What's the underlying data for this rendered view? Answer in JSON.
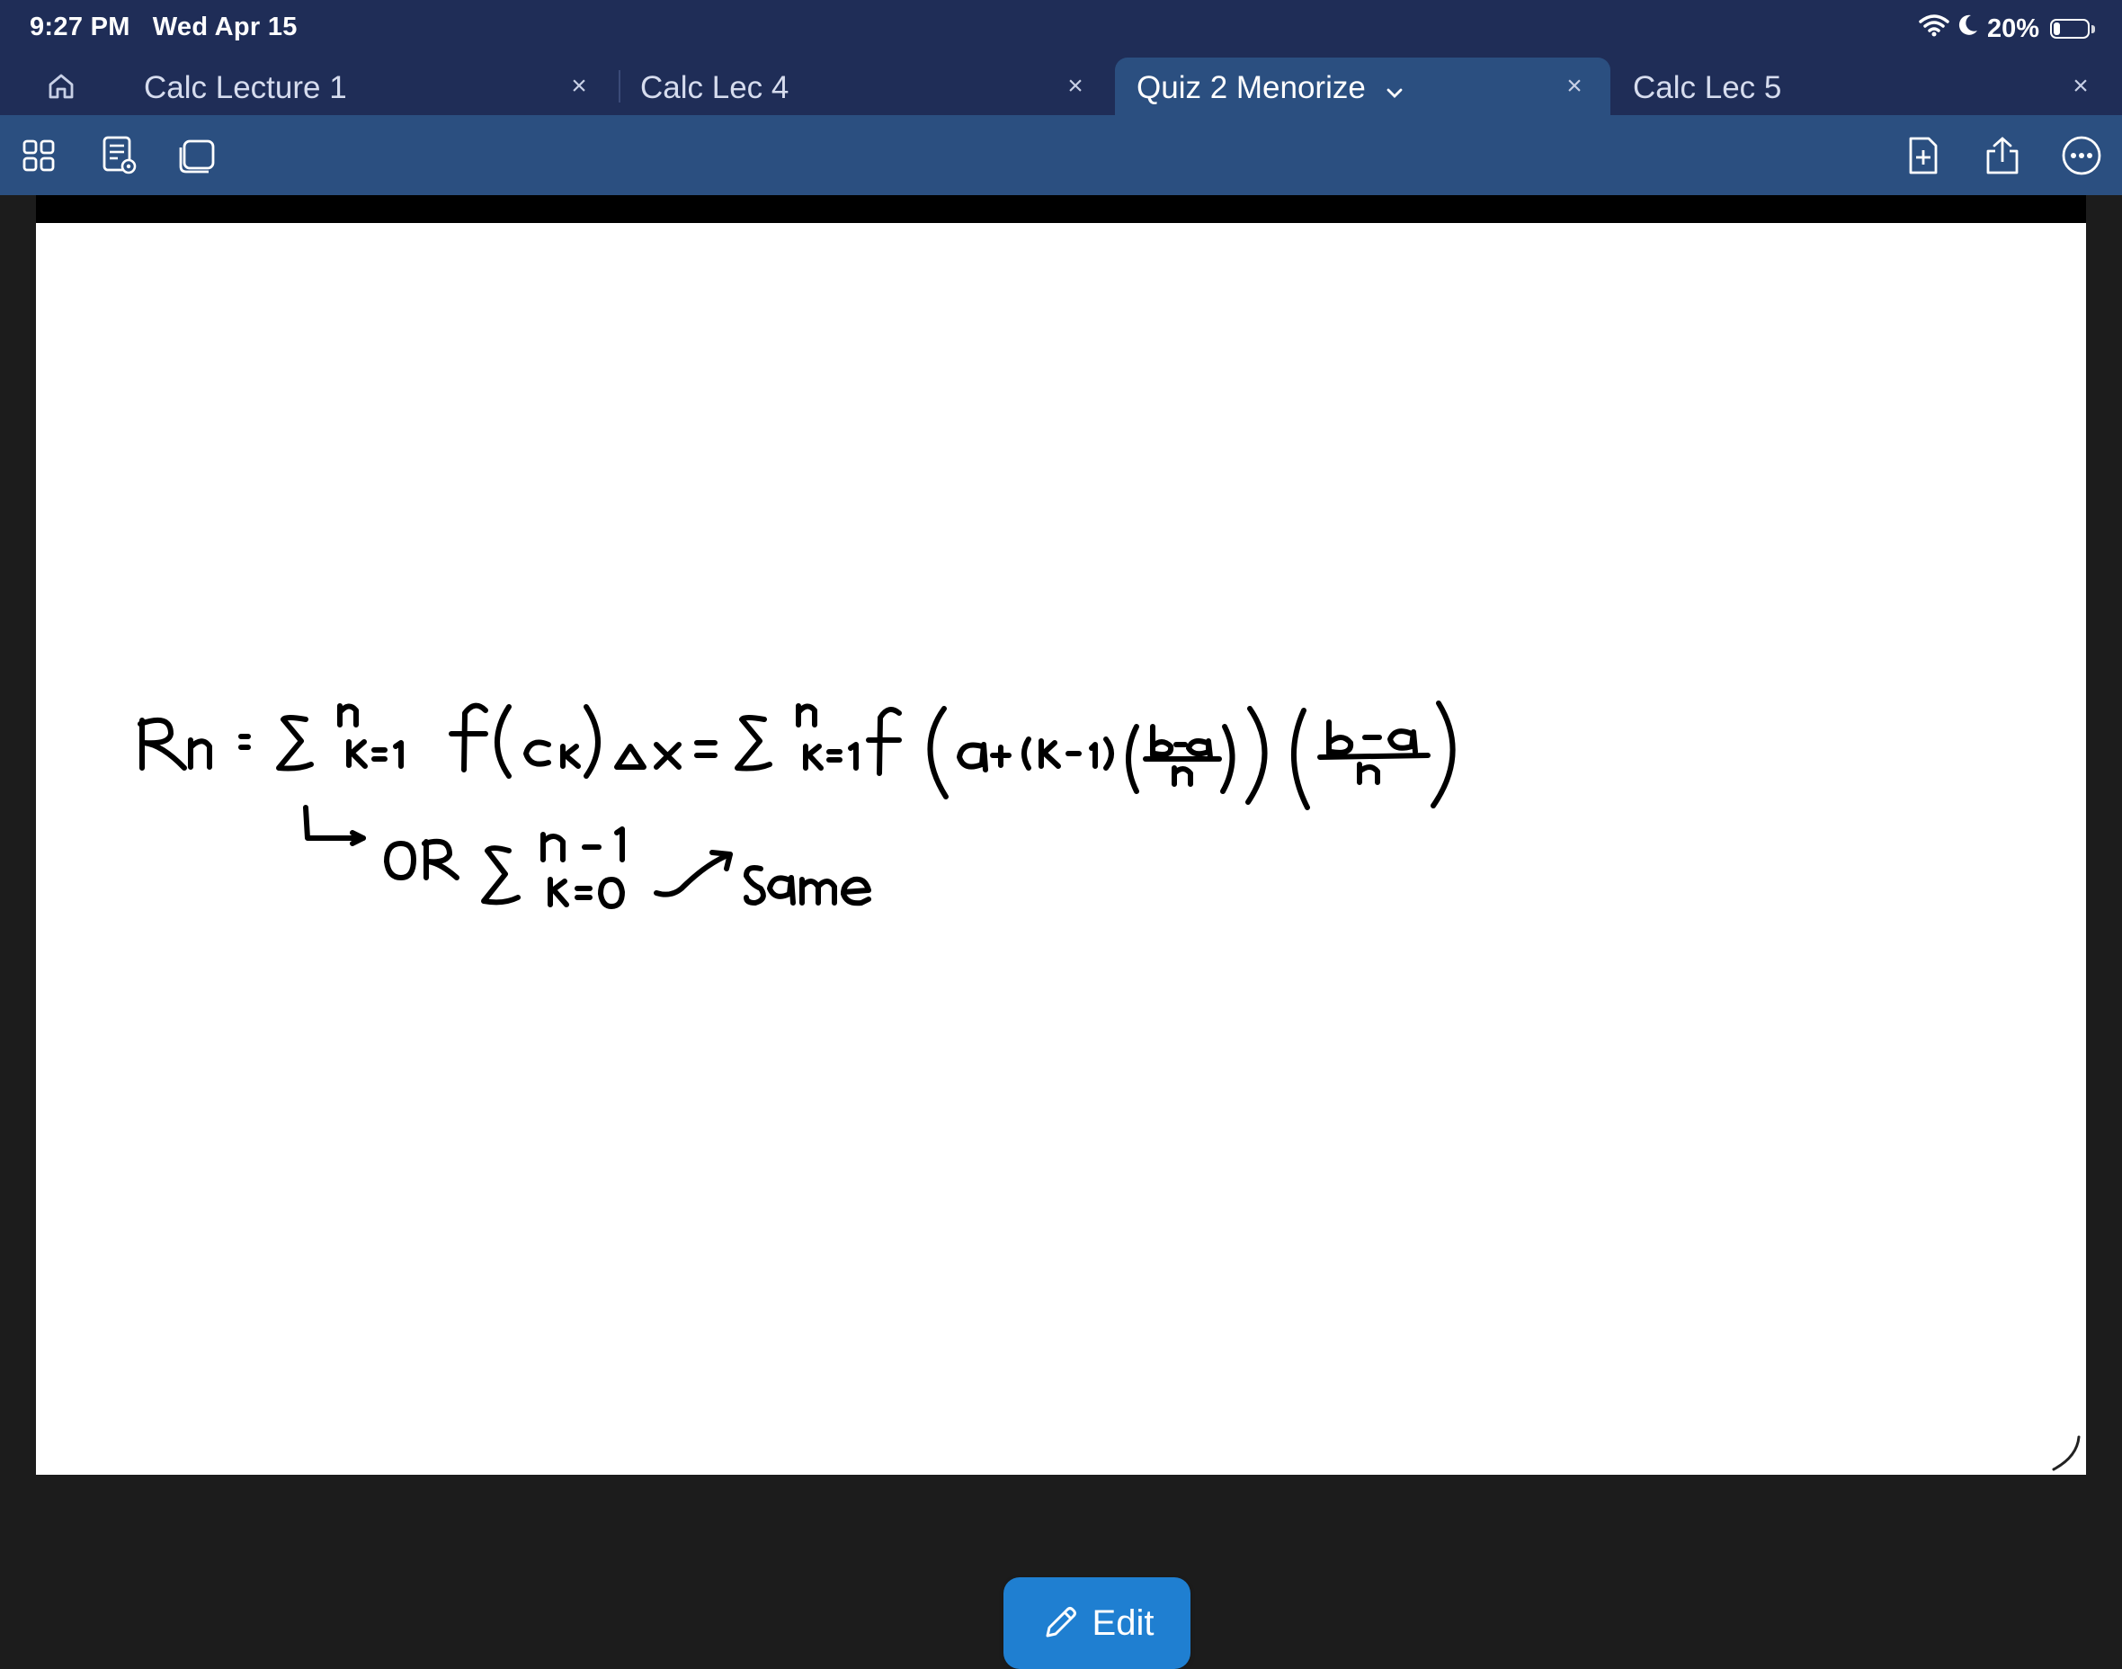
{
  "status_bar": {
    "time": "9:27 PM",
    "date": "Wed Apr 15",
    "battery_percent": "20%",
    "battery_level": 0.2
  },
  "tabs": [
    {
      "label": "Calc Lecture 1",
      "active": false
    },
    {
      "label": "Calc Lec 4",
      "active": false
    },
    {
      "label": "Quiz 2 Menorize",
      "active": true
    },
    {
      "label": "Calc Lec 5",
      "active": false
    }
  ],
  "tab_close_glyph": "×",
  "toolbar": {
    "left_icons": [
      "grid-icon",
      "document-view-icon",
      "page-stack-icon"
    ],
    "right_icons": [
      "add-page-icon",
      "share-icon",
      "more-icon"
    ]
  },
  "edit_button": {
    "label": "Edit"
  },
  "colors": {
    "bar_dark": "#1f2d57",
    "toolbar": "#2b4f80",
    "edit_button": "#1f7fd1"
  }
}
